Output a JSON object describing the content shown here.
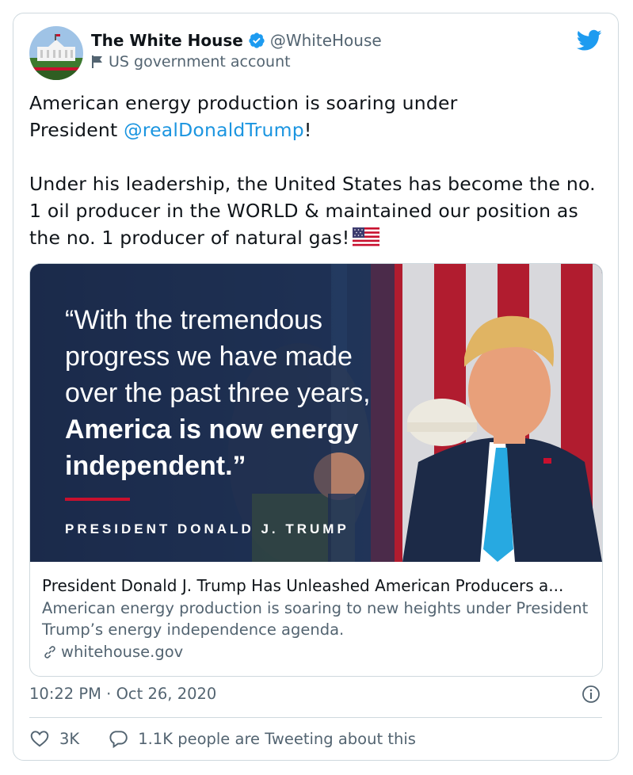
{
  "account": {
    "name": "The White House",
    "handle": "@WhiteHouse",
    "label": "US government account"
  },
  "tweet": {
    "line1": "American energy production is soaring under",
    "line2_prefix": "President ",
    "mention": "@realDonaldTrump",
    "line2_suffix": "!",
    "paragraph2": "Under his leadership, the United States has become the no. 1 oil producer in the WORLD & maintained our position as the no. 1 producer of natural gas!"
  },
  "media": {
    "quote_line1": "“With the tremendous",
    "quote_line2": "progress we have made",
    "quote_line3": "over the past three years,",
    "quote_bold1": "America is now energy",
    "quote_bold2": "independent.”",
    "attribution": "PRESIDENT DONALD J. TRUMP"
  },
  "link_card": {
    "title": "President Donald J. Trump Has Unleashed American Producers a...",
    "description": "American energy production is soaring to new heights under President Trump’s energy independence agenda.",
    "domain": "whitehouse.gov"
  },
  "meta": {
    "timestamp": "10:22 PM · Oct 26, 2020"
  },
  "actions": {
    "likes": "3K",
    "tweeting": "1.1K people are Tweeting about this"
  },
  "colors": {
    "accent": "#1b95e0",
    "secondary_text": "#536471",
    "border": "#cfd9de"
  }
}
